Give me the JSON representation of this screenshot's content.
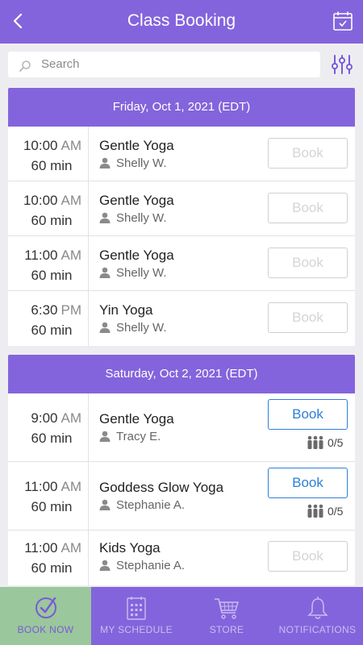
{
  "header": {
    "title": "Class Booking"
  },
  "search": {
    "placeholder": "Search"
  },
  "days": [
    {
      "label": "Friday, Oct 1, 2021 (EDT)",
      "classes": [
        {
          "time": "10:00",
          "ampm": "AM",
          "duration": "60 min",
          "name": "Gentle Yoga",
          "instructor": "Shelly W.",
          "button": "Book",
          "bookable": false
        },
        {
          "time": "10:00",
          "ampm": "AM",
          "duration": "60 min",
          "name": "Gentle Yoga",
          "instructor": "Shelly W.",
          "button": "Book",
          "bookable": false
        },
        {
          "time": "11:00",
          "ampm": "AM",
          "duration": "60 min",
          "name": "Gentle Yoga",
          "instructor": "Shelly W.",
          "button": "Book",
          "bookable": false
        },
        {
          "time": "6:30",
          "ampm": "PM",
          "duration": "60 min",
          "name": "Yin Yoga",
          "instructor": "Shelly W.",
          "button": "Book",
          "bookable": false
        }
      ]
    },
    {
      "label": "Saturday, Oct 2, 2021 (EDT)",
      "classes": [
        {
          "time": "9:00",
          "ampm": "AM",
          "duration": "60 min",
          "name": "Gentle Yoga",
          "instructor": "Tracy E.",
          "button": "Book",
          "bookable": true,
          "capacity": "0/5"
        },
        {
          "time": "11:00",
          "ampm": "AM",
          "duration": "60 min",
          "name": "Goddess Glow Yoga",
          "instructor": "Stephanie A.",
          "button": "Book",
          "bookable": true,
          "capacity": "0/5"
        },
        {
          "time": "11:00",
          "ampm": "AM",
          "duration": "60 min",
          "name": "Kids Yoga",
          "instructor": "Stephanie A.",
          "button": "Book",
          "bookable": false
        }
      ]
    }
  ],
  "tabs": [
    {
      "label": "BOOK NOW",
      "icon": "check-circle-icon",
      "selected": true
    },
    {
      "label": "MY SCHEDULE",
      "icon": "schedule-icon",
      "selected": false
    },
    {
      "label": "STORE",
      "icon": "cart-icon",
      "selected": false
    },
    {
      "label": "NOTIFICATIONS",
      "icon": "bell-icon",
      "selected": false
    }
  ],
  "colors": {
    "primary": "#8464dc",
    "selected_tab": "#9bc79c",
    "book_active": "#2d7fd8"
  }
}
